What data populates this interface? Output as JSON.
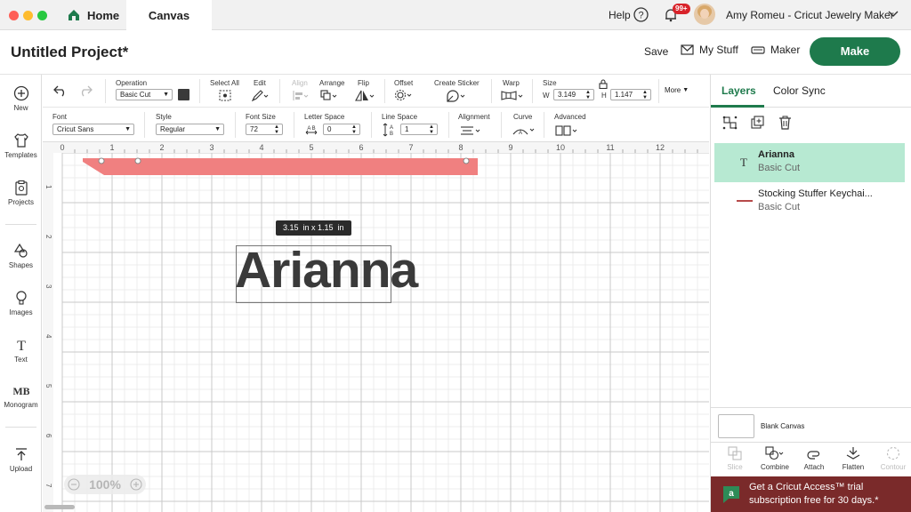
{
  "titlebar": {
    "home_label": "Home",
    "canvas_label": "Canvas",
    "help_label": "Help",
    "notif_badge": "99+",
    "user_name": "Amy Romeu - Cricut Jewelry Maker"
  },
  "project": {
    "title": "Untitled Project*",
    "save_label": "Save",
    "mystuff_label": "My Stuff",
    "machine_label": "Maker",
    "make_label": "Make",
    "make_color": "#1e7a4c"
  },
  "leftnav": {
    "items": [
      {
        "label": "New",
        "icon": "plus-circle-icon"
      },
      {
        "label": "Templates",
        "icon": "shirt-icon"
      },
      {
        "label": "Projects",
        "icon": "clipboard-icon"
      },
      {
        "label": "Shapes",
        "icon": "shapes-icon"
      },
      {
        "label": "Images",
        "icon": "lightbulb-icon"
      },
      {
        "label": "Text",
        "icon": "text-icon"
      },
      {
        "label": "Monogram",
        "icon": "monogram-icon"
      },
      {
        "label": "Upload",
        "icon": "upload-icon"
      }
    ]
  },
  "toolbar1": {
    "operation_label": "Operation",
    "operation_value": "Basic Cut",
    "select_all_label": "Select All",
    "edit_label": "Edit",
    "align_label": "Align",
    "arrange_label": "Arrange",
    "flip_label": "Flip",
    "offset_label": "Offset",
    "create_sticker_label": "Create Sticker",
    "warp_label": "Warp",
    "size_label": "Size",
    "w_label": "W",
    "w_value": "3.149",
    "h_label": "H",
    "h_value": "1.147",
    "more_label": "More"
  },
  "toolbar2": {
    "font_label": "Font",
    "font_value": "Cricut Sans",
    "style_label": "Style",
    "style_value": "Regular",
    "font_size_label": "Font Size",
    "font_size_value": "72",
    "letter_space_label": "Letter Space",
    "letter_space_value": "0",
    "line_space_label": "Line Space",
    "line_space_value": "1",
    "alignment_label": "Alignment",
    "curve_label": "Curve",
    "advanced_label": "Advanced"
  },
  "canvas": {
    "ruler_x": [
      "0",
      "1",
      "2",
      "3",
      "4",
      "5",
      "6",
      "7",
      "8",
      "9",
      "10",
      "11",
      "12"
    ],
    "ruler_y": [
      "1",
      "2",
      "3",
      "4",
      "5",
      "6",
      "7"
    ],
    "dimension_tooltip": "3.15  in x 1.15  in",
    "text_object": "Arianna",
    "keychain_color": "#f08080",
    "zoom_label": "100%"
  },
  "rightpanel": {
    "tab_layers": "Layers",
    "tab_color_sync": "Color Sync",
    "accent_color": "#1e7a4c",
    "layers": [
      {
        "name": "Arianna",
        "operation": "Basic Cut",
        "icon": "text-type-icon",
        "selected": true
      },
      {
        "name": "Stocking Stuffer Keychai...",
        "operation": "Basic Cut",
        "icon": "line-swatch-icon",
        "selected": false
      }
    ],
    "blank_canvas_label": "Blank Canvas",
    "bottom_tools": [
      {
        "label": "Slice",
        "enabled": false
      },
      {
        "label": "Combine",
        "enabled": true
      },
      {
        "label": "Attach",
        "enabled": true
      },
      {
        "label": "Flatten",
        "enabled": true
      },
      {
        "label": "Contour",
        "enabled": false
      }
    ],
    "promo_line1": "Get a Cricut Access™ trial",
    "promo_line2": "subscription free for 30 days.*"
  }
}
